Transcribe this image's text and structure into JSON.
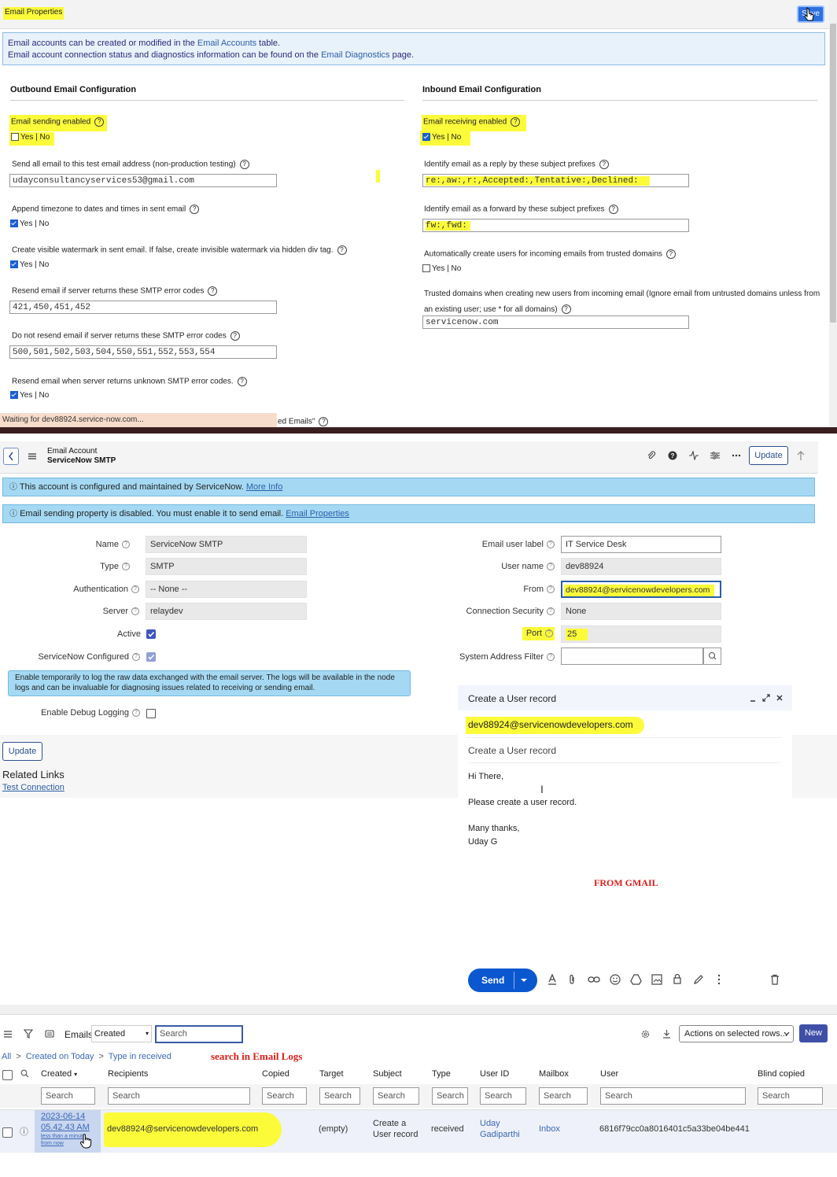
{
  "email_properties": {
    "title": "Email Properties",
    "save_button": "Save",
    "info_line1_prefix": "Email accounts can be created or modified in the ",
    "info_line1_link": "Email Accounts",
    "info_line1_suffix": " table.",
    "info_line2_prefix": "Email account connection status and diagnostics information can be found on the ",
    "info_line2_link": "Email Diagnostics",
    "info_line2_suffix": " page.",
    "outbound": {
      "heading": "Outbound Email Configuration",
      "sending_enabled_label": "Email sending enabled",
      "sending_enabled_yesno": "Yes | No",
      "test_email_label": "Send all email to this test email address (non-production testing)",
      "test_email_value": "udayconsultancyservices53@gmail.com",
      "timezone_label": "Append timezone to dates and times in sent email",
      "timezone_yesno": "Yes | No",
      "watermark_label": "Create visible watermark in sent email. If false, create invisible watermark via hidden div tag.",
      "watermark_yesno": "Yes | No",
      "resend_label": "Resend email if server returns these SMTP error codes",
      "resend_value": "421,450,451,452",
      "noresend_label": "Do not resend email if server returns these SMTP error codes",
      "noresend_value": "500,501,502,503,504,550,551,552,553,554",
      "unknown_label": "Resend email when server returns unknown SMTP error codes.",
      "unknown_yesno": "Yes | No"
    },
    "inbound": {
      "heading": "Inbound Email Configuration",
      "receiving_enabled_label": "Email receiving enabled",
      "receiving_enabled_yesno": "Yes | No",
      "reply_prefix_label": "Identify email as a reply by these subject prefixes",
      "reply_prefix_value": "re:,aw:,r:,Accepted:,Tentative:,Declined:",
      "forward_prefix_label": "Identify email as a forward by these subject prefixes",
      "forward_prefix_value": "fw:,fwd:",
      "auto_create_label": "Automatically create users for incoming emails from trusted domains",
      "auto_create_yesno": "Yes | No",
      "trusted_label_line1": "Trusted domains when creating new users from incoming email (Ignore email from untrusted domains unless from",
      "trusted_label_line2": "an existing user; use * for all domains)",
      "trusted_value": "servicenow.com"
    },
    "status_bar": "Waiting for dev88924.service-now.com...",
    "partial_text": "ed Emails\""
  },
  "email_account": {
    "header_line1": "Email Account",
    "header_line2": "ServiceNow SMTP",
    "update_button": "Update",
    "info1_text": "This account is configured and maintained by ServiceNow.",
    "info1_link": "More Info",
    "info2_text": "Email sending property is disabled. You must enable it to send email.",
    "info2_link": "Email Properties",
    "fields_left": [
      {
        "label": "Name",
        "value": "ServiceNow SMTP"
      },
      {
        "label": "Type",
        "value": "SMTP"
      },
      {
        "label": "Authentication",
        "value": "-- None --"
      },
      {
        "label": "Server",
        "value": "relaydev"
      },
      {
        "label": "Active",
        "value": ""
      },
      {
        "label": "ServiceNow Configured",
        "value": ""
      }
    ],
    "fields_right": [
      {
        "label": "Email user label",
        "value": "IT Service Desk"
      },
      {
        "label": "User name",
        "value": "dev88924"
      },
      {
        "label": "From",
        "value": "dev88924@servicenowdevelopers.com"
      },
      {
        "label": "Connection Security",
        "value": "None"
      },
      {
        "label": "Port",
        "value": "25"
      },
      {
        "label": "System Address Filter",
        "value": ""
      }
    ],
    "tooltip_text": "Enable temporarily to log the raw data exchanged with the email server. The logs will be available in the node logs and can be invaluable for diagnosing issues related to receiving or sending email.",
    "debug_label": "Enable Debug Logging",
    "bottom_update": "Update",
    "related_links_heading": "Related Links",
    "test_connection_link": "Test Connection"
  },
  "gmail_compose": {
    "title": "Create a User record",
    "to": "dev88924@servicenowdevelopers.com",
    "subject": "Create a User record",
    "body_line1": "Hi There,",
    "body_line2": "Please create a user record.",
    "body_line3": "Many thanks,",
    "body_line4": "Uday G",
    "annotation": "FROM GMAIL",
    "send_button": "Send"
  },
  "email_logs": {
    "list_title": "Emails",
    "filter_field": "Created",
    "search_placeholder": "Search",
    "actions_select": "Actions on selected rows...",
    "new_button": "New",
    "breadcrumb_all": "All",
    "breadcrumb_sep": ">",
    "breadcrumb_1": "Created on Today",
    "breadcrumb_2": "Type in received",
    "annotation": "search in Email Logs",
    "columns": [
      "Created",
      "Recipients",
      "Copied",
      "Target",
      "Subject",
      "Type",
      "User ID",
      "Mailbox",
      "User",
      "Blind copied"
    ],
    "row": {
      "created_date": "2023-06-14",
      "created_time": "05.42.43 AM",
      "created_rel1": "less than a minute",
      "created_rel2": "from now",
      "recipients": "dev88924@servicenowdevelopers.com",
      "target": "(empty)",
      "subject_line1": "Create a",
      "subject_line2": "User record",
      "type": "received",
      "user_id_line1": "Uday",
      "user_id_line2": "Gadiparthi",
      "mailbox": "Inbox",
      "user": "6816f79cc0a8016401c5a33be04be441"
    }
  },
  "colors": {
    "highlight": "#fbfb3a",
    "link": "#2b5ea8",
    "info_blue": "#a5d9f3",
    "annotation_red": "#d8201a",
    "gmail_send": "#0b57d0"
  }
}
